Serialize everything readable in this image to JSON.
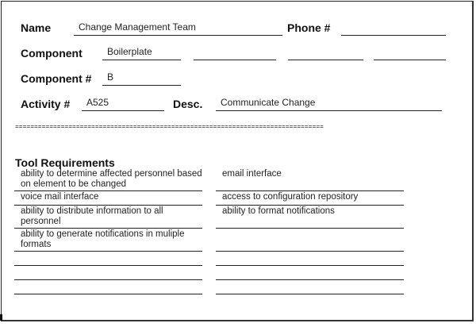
{
  "header": {
    "name_label": "Name",
    "name_value": "Change Management Team",
    "phone_label": "Phone #",
    "phone_value": "",
    "component_label": "Component",
    "component_values": [
      "Boilerplate",
      "",
      "",
      ""
    ],
    "component_num_label": "Component #",
    "component_num_value": "B",
    "activity_label": "Activity  #",
    "activity_value": "A525",
    "desc_label": "Desc.",
    "desc_value": "Communicate Change"
  },
  "separator": "=================================================================================",
  "tool_requirements": {
    "heading": "Tool Requirements",
    "left": [
      "ability to determine affected personnel based on element to be changed",
      "voice mail interface",
      "ability to distribute information to all personnel",
      "ability to generate notifications in muliple formats",
      "",
      "",
      ""
    ],
    "right": [
      "email interface",
      "access to configuration repository",
      "ability to format notifications",
      "",
      "",
      "",
      ""
    ]
  }
}
